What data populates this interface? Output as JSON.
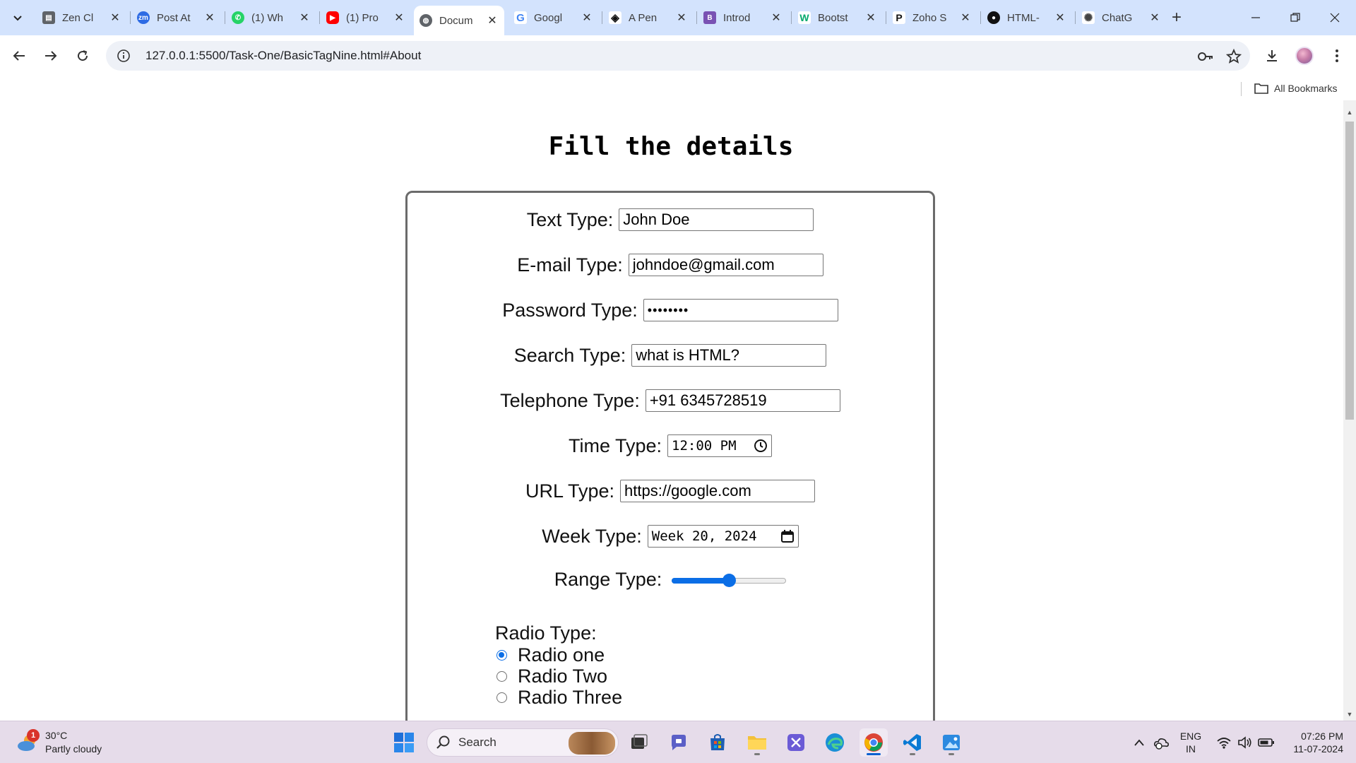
{
  "browser": {
    "tabs": [
      {
        "title": "Zen Cl",
        "icon": "zen-class-icon",
        "color": "#5f6368"
      },
      {
        "title": "Post At",
        "icon": "zoom-icon",
        "color": "#2d6be4"
      },
      {
        "title": "(1) Wh",
        "icon": "whatsapp-icon",
        "color": "#25d366"
      },
      {
        "title": "(1) Pro",
        "icon": "youtube-icon",
        "color": "#ff0000"
      },
      {
        "title": "Docum",
        "icon": "globe-icon",
        "color": "#5f6368"
      },
      {
        "title": "Googl",
        "icon": "google-icon",
        "color": "#4285f4"
      },
      {
        "title": "A Pen",
        "icon": "codepen-icon",
        "color": "#111111"
      },
      {
        "title": "Introd",
        "icon": "bootstrap-icon",
        "color": "#7952b3"
      },
      {
        "title": "Bootst",
        "icon": "w3schools-icon",
        "color": "#04aa6d"
      },
      {
        "title": "Zoho S",
        "icon": "zoho-icon",
        "color": "#111111"
      },
      {
        "title": "HTML-",
        "icon": "github-icon",
        "color": "#111111"
      },
      {
        "title": "ChatG",
        "icon": "chatgpt-icon",
        "color": "#444444"
      }
    ],
    "active_tab_index": 4,
    "url": "127.0.0.1:5500/Task-One/BasicTagNine.html#About",
    "bookmarks_label": "All Bookmarks"
  },
  "page": {
    "title": "Fill the details",
    "fields": {
      "text": {
        "label": "Text Type:",
        "value": "John Doe"
      },
      "email": {
        "label": "E-mail Type:",
        "value": "johndoe@gmail.com"
      },
      "password": {
        "label": "Password Type:",
        "value": "••••••••"
      },
      "search": {
        "label": "Search Type:",
        "value": "what is HTML?"
      },
      "tel": {
        "label": "Telephone Type:",
        "value": "+91 6345728519"
      },
      "time": {
        "label": "Time Type:",
        "value": "12:00 PM"
      },
      "url": {
        "label": "URL Type:",
        "value": "https://google.com"
      },
      "week": {
        "label": "Week Type:",
        "value": "Week 20, 2024"
      },
      "range": {
        "label": "Range Type:",
        "value": 0.5
      }
    },
    "radio": {
      "label": "Radio Type:",
      "options": [
        "Radio one",
        "Radio Two",
        "Radio Three"
      ],
      "selected": 0
    }
  },
  "taskbar": {
    "weather": {
      "temp": "30°C",
      "desc": "Partly cloudy",
      "badge": "1"
    },
    "search_label": "Search",
    "lang": {
      "line1": "ENG",
      "line2": "IN"
    },
    "clock": {
      "time": "07:26 PM",
      "date": "11-07-2024"
    }
  },
  "colors": {
    "accent": "#0b6ee6",
    "tabstrip": "#d3e3fd",
    "taskbar": "#e6dcea"
  }
}
